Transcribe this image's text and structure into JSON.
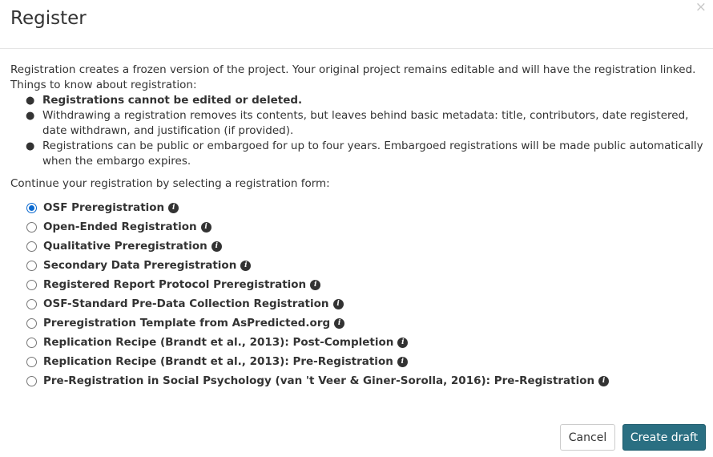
{
  "header": {
    "title": "Register",
    "close_glyph": "×"
  },
  "body": {
    "intro_line1": "Registration creates a frozen version of the project. Your original project remains editable and will have the registration linked.",
    "intro_line2": "Things to know about registration:",
    "rules": [
      "Registrations cannot be edited or deleted.",
      "Withdrawing a registration removes its contents, but leaves behind basic metadata: title, contributors, date registered, date withdrawn, and justification (if provided).",
      "Registrations can be public or embargoed for up to four years. Embargoed registrations will be made public automatically when the embargo expires."
    ],
    "continue_text": "Continue your registration by selecting a registration form:"
  },
  "forms": {
    "selected_index": 0,
    "items": [
      "OSF Preregistration",
      "Open-Ended Registration",
      "Qualitative Preregistration",
      "Secondary Data Preregistration",
      "Registered Report Protocol Preregistration",
      "OSF-Standard Pre-Data Collection Registration",
      "Preregistration Template from AsPredicted.org",
      "Replication Recipe (Brandt et al., 2013): Post-Completion",
      "Replication Recipe (Brandt et al., 2013): Pre-Registration",
      "Pre-Registration in Social Psychology (van 't Veer & Giner-Sorolla, 2016): Pre-Registration"
    ],
    "info_glyph": "i",
    "info_icon": "info-circle-icon"
  },
  "footer": {
    "cancel_label": "Cancel",
    "create_label": "Create draft"
  },
  "colors": {
    "primary_button": "#2a6f82",
    "radio_selected": "#0a69d0"
  }
}
